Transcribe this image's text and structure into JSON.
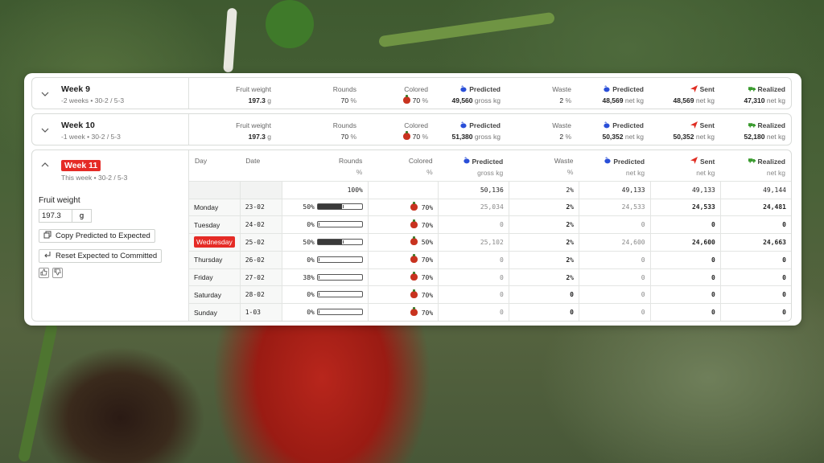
{
  "weeks_collapsed": [
    {
      "title": "Week 9",
      "subtitle": "-2 weeks • 30-2 / 5-3",
      "fruit_weight": {
        "label": "Fruit weight",
        "value": "197.3",
        "unit": "g"
      },
      "rounds": {
        "label": "Rounds",
        "value": "70",
        "unit": "%"
      },
      "colored": {
        "label": "Colored",
        "value": "70",
        "unit": "%"
      },
      "predicted_gross": {
        "label": "Predicted",
        "value": "49,560",
        "unit": "gross kg"
      },
      "waste": {
        "label": "Waste",
        "value": "2",
        "unit": "%"
      },
      "predicted_net": {
        "label": "Predicted",
        "value": "48,569",
        "unit": "net kg"
      },
      "sent": {
        "label": "Sent",
        "value": "48,569",
        "unit": "net kg"
      },
      "realized": {
        "label": "Realized",
        "value": "47,310",
        "unit": "net kg"
      }
    },
    {
      "title": "Week 10",
      "subtitle": "-1 week • 30-2 / 5-3",
      "fruit_weight": {
        "label": "Fruit weight",
        "value": "197.3",
        "unit": "g"
      },
      "rounds": {
        "label": "Rounds",
        "value": "70",
        "unit": "%"
      },
      "colored": {
        "label": "Colored",
        "value": "70",
        "unit": "%"
      },
      "predicted_gross": {
        "label": "Predicted",
        "value": "51,380",
        "unit": "gross kg"
      },
      "waste": {
        "label": "Waste",
        "value": "2",
        "unit": "%"
      },
      "predicted_net": {
        "label": "Predicted",
        "value": "50,352",
        "unit": "net kg"
      },
      "sent": {
        "label": "Sent",
        "value": "50,352",
        "unit": "net kg"
      },
      "realized": {
        "label": "Realized",
        "value": "52,180",
        "unit": "net kg"
      }
    }
  ],
  "week11": {
    "title": "Week 11",
    "subtitle": "This week • 30-2 / 5-3",
    "fruit_weight_label": "Fruit weight",
    "fruit_weight_value": "197.3",
    "fruit_weight_unit": "g",
    "copy_button": "Copy Predicted to Expected",
    "reset_button": "Reset Expected to Committed",
    "headers": {
      "day": "Day",
      "date": "Date",
      "rounds": "Rounds",
      "rounds_unit": "%",
      "colored": "Colored",
      "colored_unit": "%",
      "predicted_gross": "Predicted",
      "predicted_gross_unit": "gross kg",
      "waste": "Waste",
      "waste_unit": "%",
      "predicted_net": "Predicted",
      "predicted_net_unit": "net kg",
      "sent": "Sent",
      "sent_unit": "net kg",
      "realized": "Realized",
      "realized_unit": "net kg"
    },
    "totals": {
      "rounds": "100%",
      "predicted_gross": "50,136",
      "waste": "2%",
      "predicted_net": "49,133",
      "sent": "49,133",
      "realized": "49,144"
    },
    "rows": [
      {
        "day": "Monday",
        "date": "23-02",
        "rounds": "50%",
        "rounds_fill": 0.55,
        "colored": "70%",
        "predicted_gross": "25,034",
        "waste": "2%",
        "predicted_net": "24,533",
        "sent": "24,533",
        "realized": "24,481"
      },
      {
        "day": "Tuesday",
        "date": "24-02",
        "rounds": "0%",
        "rounds_fill": 0,
        "colored": "70%",
        "predicted_gross": "0",
        "waste": "2%",
        "predicted_net": "0",
        "sent": "0",
        "realized": "0"
      },
      {
        "day": "Wednesday",
        "date": "25-02",
        "rounds": "50%",
        "rounds_fill": 0.55,
        "colored": "50%",
        "predicted_gross": "25,102",
        "waste": "2%",
        "predicted_net": "24,600",
        "sent": "24,600",
        "realized": "24,663"
      },
      {
        "day": "Thursday",
        "date": "26-02",
        "rounds": "0%",
        "rounds_fill": 0,
        "colored": "70%",
        "predicted_gross": "0",
        "waste": "2%",
        "predicted_net": "0",
        "sent": "0",
        "realized": "0"
      },
      {
        "day": "Friday",
        "date": "27-02",
        "rounds": "38%",
        "rounds_fill": 0,
        "colored": "70%",
        "predicted_gross": "0",
        "waste": "2%",
        "predicted_net": "0",
        "sent": "0",
        "realized": "0"
      },
      {
        "day": "Saturday",
        "date": "28-02",
        "rounds": "0%",
        "rounds_fill": 0,
        "colored": "70%",
        "predicted_gross": "0",
        "waste": "0",
        "predicted_net": "0",
        "sent": "0",
        "realized": "0"
      },
      {
        "day": "Sunday",
        "date": "1-03",
        "rounds": "0%",
        "rounds_fill": 0,
        "colored": "70%",
        "predicted_gross": "0",
        "waste": "0",
        "predicted_net": "0",
        "sent": "0",
        "realized": "0"
      }
    ]
  },
  "colors": {
    "accent_red": "#e52b26",
    "predicted_blue": "#2a4fd8",
    "sent_red": "#e02d22",
    "realized_green": "#3a9b2f"
  }
}
